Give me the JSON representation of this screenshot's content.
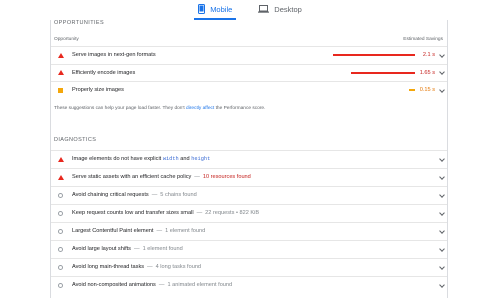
{
  "tabs": [
    {
      "label": "Mobile",
      "icon": "phone-icon",
      "active": true
    },
    {
      "label": "Desktop",
      "icon": "laptop-icon",
      "active": false
    }
  ],
  "opportunities": {
    "title": "OPPORTUNITIES",
    "column_opportunity": "Opportunity",
    "column_savings": "Estimated Savings",
    "items": [
      {
        "label": "Serve images in next-gen formats",
        "savings": "2.1 s",
        "severity": "fail",
        "bar_fraction": 1.0
      },
      {
        "label": "Efficiently encode images",
        "savings": "1.65 s",
        "severity": "fail",
        "bar_fraction": 0.786
      },
      {
        "label": "Properly size images",
        "savings": "0.15 s",
        "severity": "average",
        "bar_fraction": 0.071
      }
    ],
    "note_before": "These suggestions can help your page load faster. They don't",
    "note_link": "directly affect",
    "note_after": "the Performance score."
  },
  "diagnostics": {
    "title": "DIAGNOSTICS",
    "items": [
      {
        "label_before": "Image elements do not have explicit",
        "code1": "width",
        "label_mid": "and",
        "code2": "height",
        "detail": "",
        "severity": "fail"
      },
      {
        "label": "Serve static assets with an efficient cache policy",
        "detail": "10 resources found",
        "detail_color": "red",
        "severity": "fail"
      },
      {
        "label": "Avoid chaining critical requests",
        "detail": "5 chains found",
        "severity": "info"
      },
      {
        "label": "Keep request counts low and transfer sizes small",
        "detail": "22 requests • 822 KiB",
        "severity": "info"
      },
      {
        "label": "Largest Contentful Paint element",
        "detail": "1 element found",
        "severity": "info"
      },
      {
        "label": "Avoid large layout shifts",
        "detail": "1 element found",
        "severity": "info"
      },
      {
        "label": "Avoid long main-thread tasks",
        "detail": "4 long tasks found",
        "severity": "info"
      },
      {
        "label": "Avoid non-composited animations",
        "detail": "1 animated element found",
        "severity": "info"
      }
    ],
    "separator": "—"
  },
  "colors": {
    "accent": "#1a73e8",
    "fail": "#e8281e",
    "average": "#f4a70b",
    "info": "#9aa0a6"
  }
}
